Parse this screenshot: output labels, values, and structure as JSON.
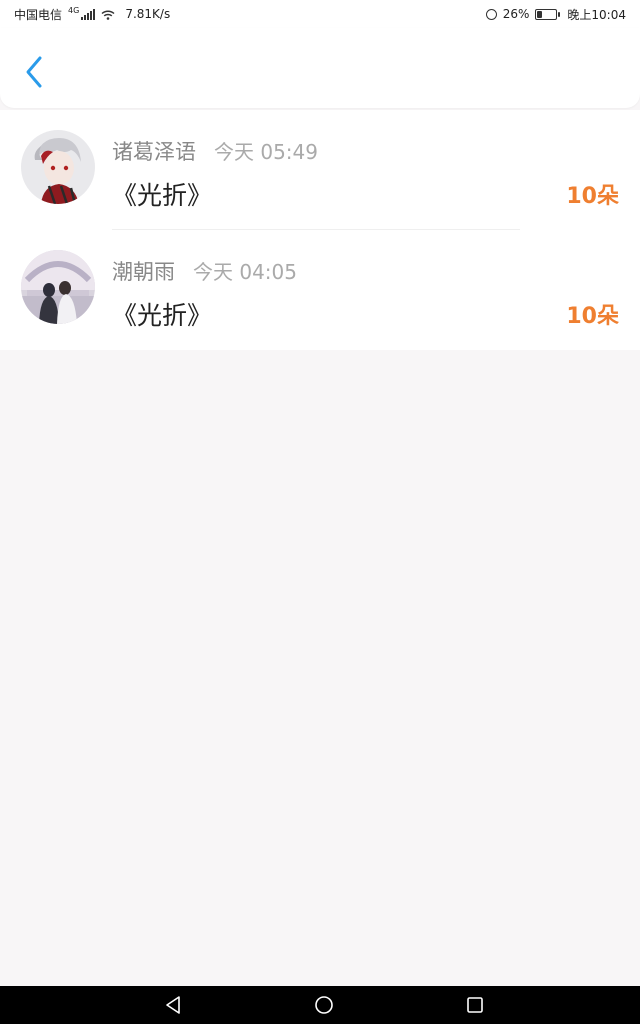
{
  "status_bar": {
    "carrier": "中国电信",
    "network": "4G",
    "speed": "7.81K/s",
    "battery": "26%",
    "battery_level": 0.26,
    "time": "晚上10:04"
  },
  "header": {
    "back_icon": "chevron-left-icon",
    "accent_color": "#2a9bea"
  },
  "gifts": [
    {
      "name": "诸葛泽语",
      "time": "今天 05:49",
      "title": "《光折》",
      "amount": "10朵"
    },
    {
      "name": "潮朝雨",
      "time": "今天 04:05",
      "title": "《光折》",
      "amount": "10朵"
    }
  ],
  "colors": {
    "amount": "#ef7f30",
    "background": "#f8f6f7"
  },
  "nav_bar": {
    "back": "triangle-back-icon",
    "home": "circle-home-icon",
    "recents": "square-recents-icon"
  }
}
